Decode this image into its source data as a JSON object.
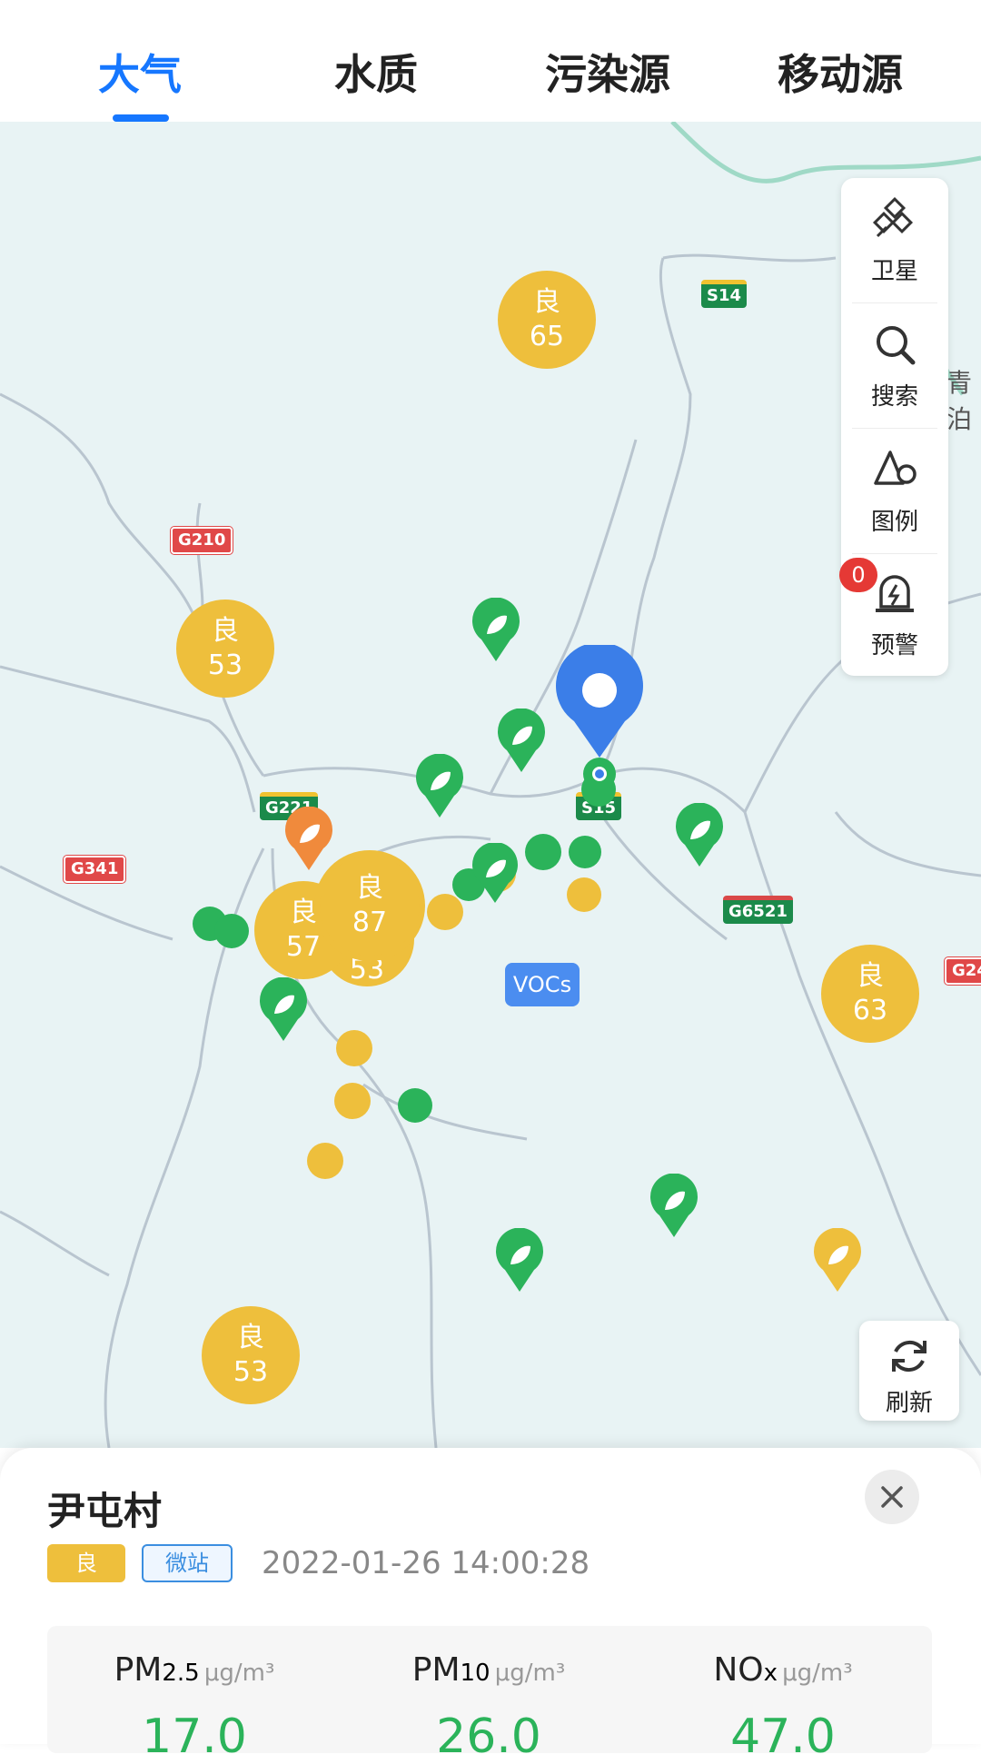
{
  "tabs": [
    {
      "label": "大气",
      "active": true
    },
    {
      "label": "水质",
      "active": false
    },
    {
      "label": "污染源",
      "active": false
    },
    {
      "label": "移动源",
      "active": false
    }
  ],
  "toolbar": {
    "satellite_label": "卫星",
    "search_label": "搜索",
    "legend_label": "图例",
    "alert_label": "预警",
    "alert_count": "0"
  },
  "refresh_label": "刷新",
  "map": {
    "clusters": [
      {
        "grade": "良",
        "value": "65"
      },
      {
        "grade": "良",
        "value": "53"
      },
      {
        "grade": "良",
        "value": "57"
      },
      {
        "grade": "良",
        "value": "87"
      },
      {
        "grade": "良",
        "value": "53"
      },
      {
        "grade": "良",
        "value": "63"
      },
      {
        "grade": "良",
        "value": "53"
      }
    ],
    "road_labels": [
      "S14",
      "G210",
      "G221",
      "G341",
      "S15",
      "G6521",
      "G24"
    ],
    "edge_text": "青泊",
    "vocs_label": "VOCs",
    "colors": {
      "good": "#eebf3c",
      "excellent": "#2bb35a",
      "moderate": "#f08a3c",
      "selected": "#3b7ee8"
    }
  },
  "station": {
    "name": "尹屯村",
    "grade_tag": "良",
    "type_tag": "微站",
    "timestamp": "2022-01-26 14:00:28",
    "metrics": [
      {
        "name": "PM",
        "sub": "2.5",
        "unit": "μg/m³",
        "value": "17.0"
      },
      {
        "name": "PM",
        "sub": "10",
        "unit": "μg/m³",
        "value": "26.0"
      },
      {
        "name": "NO",
        "sub": "x",
        "unit": "μg/m³",
        "value": "47.0"
      }
    ]
  }
}
